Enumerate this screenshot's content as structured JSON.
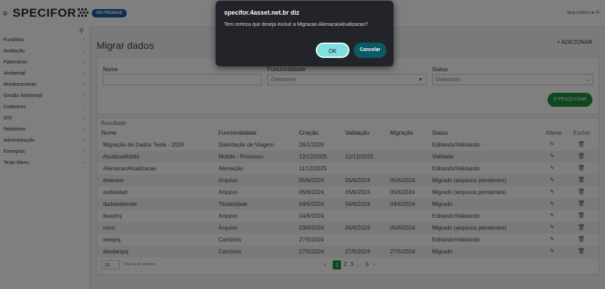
{
  "header": {
    "app_name": "SPECIFOR",
    "badge": "ON PREMISE",
    "user": "ana.carlos"
  },
  "sidebar": {
    "items": [
      {
        "label": "Fundiário"
      },
      {
        "label": "Avaliação"
      },
      {
        "label": "Patrimônio"
      },
      {
        "label": "Ambiental"
      },
      {
        "label": "Monitoramento"
      },
      {
        "label": "Gestão Ambiental"
      },
      {
        "label": "Cadastros"
      },
      {
        "label": "GIS"
      },
      {
        "label": "Relatórios"
      },
      {
        "label": "Administração"
      },
      {
        "label": "Exemplos"
      },
      {
        "label": "Teste Menu"
      }
    ]
  },
  "main": {
    "title": "Migrar dados",
    "add_label": "+ ADICIONAR"
  },
  "filters": {
    "nome_label": "Nome",
    "nome_value": "",
    "funcionalidade_label": "Funcionalidade",
    "funcionalidade_value": "(Selecione)",
    "status_label": "Status",
    "status_value": "(Selecione)",
    "search_label": "PESQUISAR"
  },
  "results": {
    "label": "Resultado",
    "headers": {
      "nome": "Nome",
      "funcionalidade": "Funcionalidade",
      "criacao": "Criação",
      "validacao": "Validação",
      "migracao": "Migração",
      "status": "Status",
      "alterar": "Alterar",
      "excluir": "Excluir"
    },
    "rows": [
      {
        "nome": "Migração de Dados Teste - 2026",
        "func": "Solicitação de Viagem",
        "criacao": "26/1/2026",
        "validacao": "",
        "migracao": "",
        "status": "Editando/Validando"
      },
      {
        "nome": "AtualizaMobile",
        "func": "Mobile - Processo",
        "criacao": "12/12/2025",
        "validacao": "12/12/2025",
        "migracao": "",
        "status": "Validado"
      },
      {
        "nome": "AlienacaoAtualizacao",
        "func": "Alienação",
        "criacao": "11/12/2025",
        "validacao": "",
        "migracao": "",
        "status": "Editando/Validando"
      },
      {
        "nome": "dwerwer",
        "func": "Arquivo",
        "criacao": "05/6/2024",
        "validacao": "05/6/2024",
        "migracao": "05/6/2024",
        "status": "Migrado (arquivos pendentes)"
      },
      {
        "nome": "asdasdad",
        "func": "Arquivo",
        "criacao": "05/6/2024",
        "validacao": "05/6/2024",
        "migracao": "05/6/2024",
        "status": "Migrado (arquivos pendentes)"
      },
      {
        "nome": "dadwedwndw",
        "func": "Titularidade",
        "criacao": "04/6/2024",
        "validacao": "04/6/2024",
        "migracao": "04/6/2024",
        "status": "Migrado"
      },
      {
        "nome": "lkiouhnj",
        "func": "Arquivo",
        "criacao": "04/6/2024",
        "validacao": "",
        "migracao": "",
        "status": "Editando/Validando"
      },
      {
        "nome": "novo",
        "func": "Arquivo",
        "criacao": "03/6/2024",
        "validacao": "05/6/2024",
        "migracao": "05/6/2024",
        "status": "Migrado (arquivos pendentes)"
      },
      {
        "nome": "wwqeq",
        "func": "Cartórios",
        "criacao": "27/5/2024",
        "validacao": "",
        "migracao": "",
        "status": "Editando/Validando"
      },
      {
        "nome": "dasdarqrq",
        "func": "Cartórios",
        "criacao": "27/5/2024",
        "validacao": "27/5/2024",
        "migracao": "27/5/2024",
        "status": "Migrado"
      }
    ]
  },
  "pagination": {
    "page_size": "10",
    "total": "Total de 43 registros",
    "prev": "‹",
    "p1": "1",
    "p2": "2",
    "p3": "3",
    "ellipsis": "...",
    "p5": "5",
    "next": "›"
  },
  "dialog": {
    "title": "specifor.4asset.net.br diz",
    "message": "Tem certeza que deseja excluir a Migracao AlienacaoAtualizacao?",
    "ok": "OK",
    "cancel": "Cancelar"
  }
}
